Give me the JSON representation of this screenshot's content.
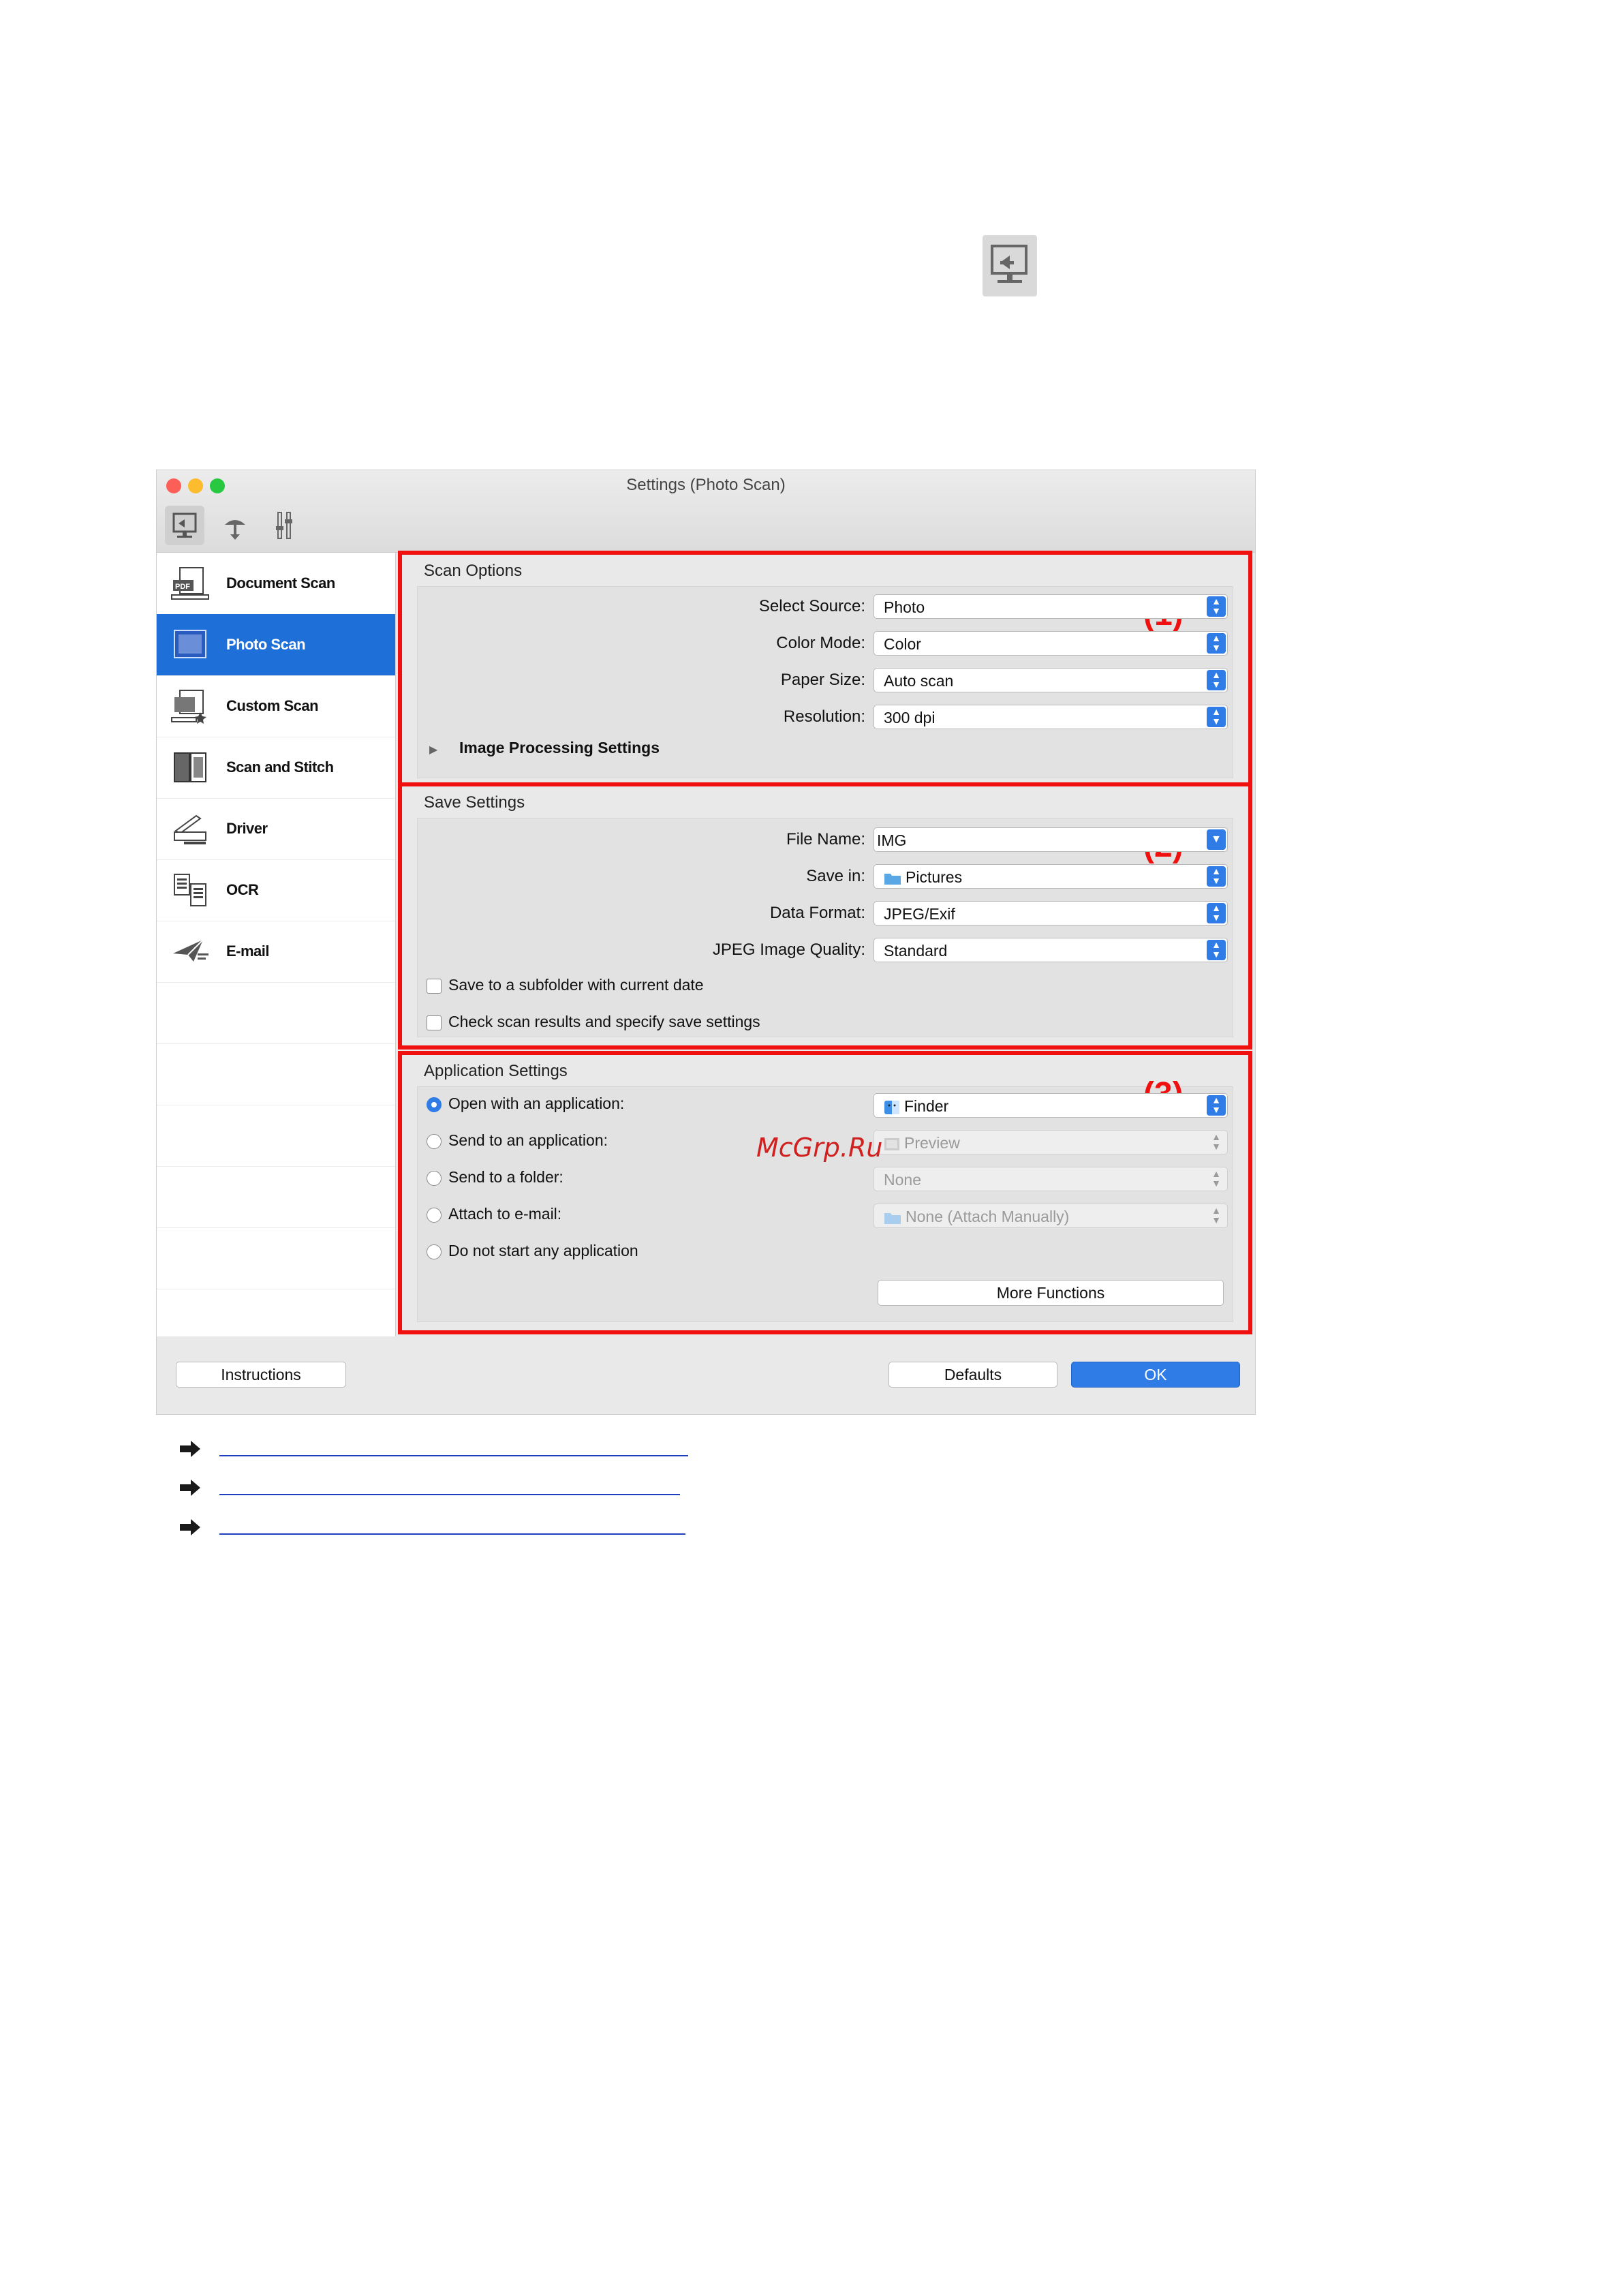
{
  "window": {
    "title": "Settings (Photo Scan)"
  },
  "sidebar": {
    "items": [
      {
        "label": "Document Scan",
        "icon": "document-scan-icon",
        "active": false
      },
      {
        "label": "Photo Scan",
        "icon": "photo-scan-icon",
        "active": true
      },
      {
        "label": "Custom Scan",
        "icon": "custom-scan-icon",
        "active": false
      },
      {
        "label": "Scan and Stitch",
        "icon": "scan-stitch-icon",
        "active": false
      },
      {
        "label": "Driver",
        "icon": "driver-icon",
        "active": false
      },
      {
        "label": "OCR",
        "icon": "ocr-icon",
        "active": false
      },
      {
        "label": "E-mail",
        "icon": "email-icon",
        "active": false
      }
    ]
  },
  "scan_options": {
    "title": "Scan Options",
    "badge": "(1)",
    "select_source": {
      "label": "Select Source:",
      "value": "Photo"
    },
    "color_mode": {
      "label": "Color Mode:",
      "value": "Color"
    },
    "paper_size": {
      "label": "Paper Size:",
      "value": "Auto scan"
    },
    "resolution": {
      "label": "Resolution:",
      "value": "300 dpi"
    },
    "image_processing": "Image Processing Settings"
  },
  "save_settings": {
    "title": "Save Settings",
    "badge": "(2)",
    "file_name": {
      "label": "File Name:",
      "value": "IMG"
    },
    "save_in": {
      "label": "Save in:",
      "value": "Pictures"
    },
    "data_format": {
      "label": "Data Format:",
      "value": "JPEG/Exif"
    },
    "jpeg_quality": {
      "label": "JPEG Image Quality:",
      "value": "Standard"
    },
    "subfolder": "Save to a subfolder with current date",
    "check_results": "Check scan results and specify save settings"
  },
  "application_settings": {
    "title": "Application Settings",
    "badge": "(3)",
    "open_with": {
      "label": "Open with an application:",
      "value": "Finder"
    },
    "send_to_app": {
      "label": "Send to an application:",
      "value": "Preview"
    },
    "send_to_folder": {
      "label": "Send to a folder:",
      "value": "None"
    },
    "attach_email": {
      "label": "Attach to e-mail:",
      "value": "None (Attach Manually)"
    },
    "no_start": {
      "label": "Do not start any application"
    },
    "more_functions": "More Functions"
  },
  "footer": {
    "instructions": "Instructions",
    "defaults": "Defaults",
    "ok": "OK"
  },
  "watermark": "McGrp.Ru",
  "colors": {
    "accent": "#2f7ce6",
    "highlight_border": "#f01010",
    "sidebar_active": "#1e6fd8",
    "link": "#1f3ebf"
  }
}
